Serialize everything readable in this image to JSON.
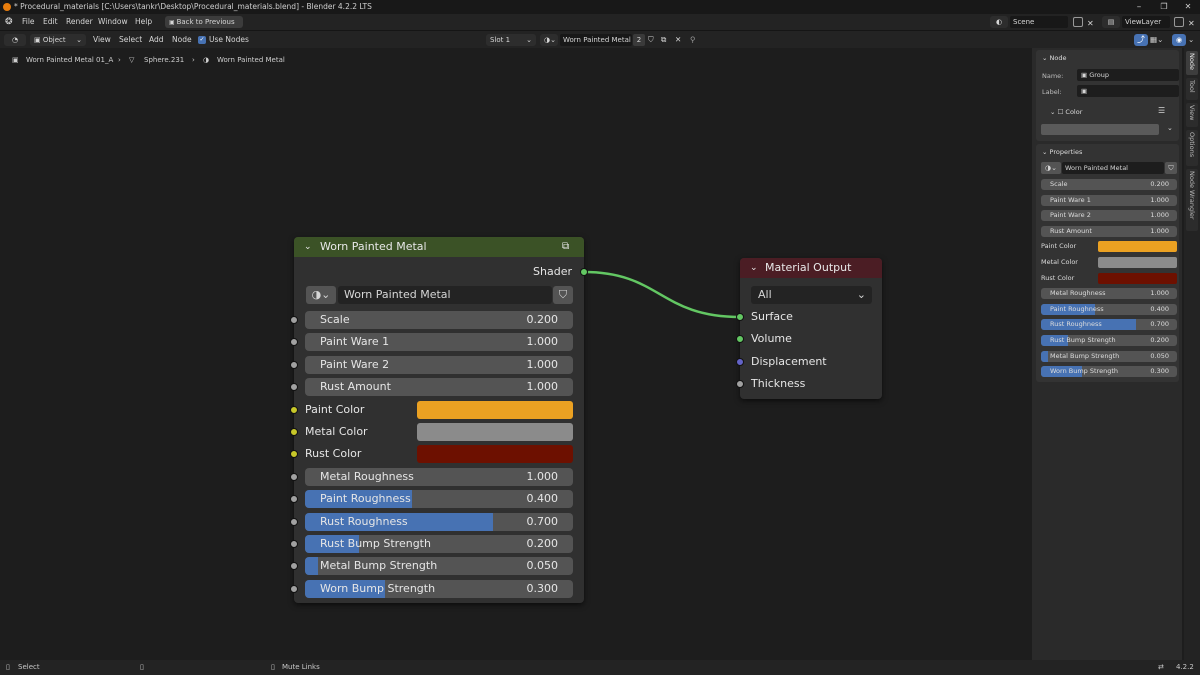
{
  "window": {
    "title": "* Procedural_materials [C:\\Users\\tankr\\Desktop\\Procedural_materials.blend] - Blender 4.2.2 LTS",
    "minimize": "–",
    "maximize": "❐",
    "close": "✕"
  },
  "menu": {
    "items": [
      "File",
      "Edit",
      "Render",
      "Window",
      "Help"
    ],
    "back_button": "Back to Previous",
    "scene": "Scene",
    "view_layer": "ViewLayer"
  },
  "header": {
    "mode": "Object",
    "menus": [
      "View",
      "Select",
      "Add",
      "Node"
    ],
    "use_nodes_label": "Use Nodes",
    "use_nodes_checked": true,
    "slot": "Slot 1",
    "material": "Worn Painted Metal",
    "users": "2"
  },
  "breadcrumb": {
    "object": "Worn Painted Metal 01_A",
    "mesh": "Sphere.231",
    "material": "Worn Painted Metal"
  },
  "group_node": {
    "title": "Worn Painted Metal",
    "output": "Shader",
    "datablock": "Worn Painted Metal",
    "inputs": [
      {
        "label": "Scale",
        "value": "0.200",
        "fill": 0
      },
      {
        "label": "Paint Ware 1",
        "value": "1.000",
        "fill": 0
      },
      {
        "label": "Paint Ware 2",
        "value": "1.000",
        "fill": 0
      },
      {
        "label": "Rust Amount",
        "value": "1.000",
        "fill": 0
      }
    ],
    "colors": [
      {
        "label": "Paint Color",
        "color": "#eba122"
      },
      {
        "label": "Metal Color",
        "color": "#8b8b8b"
      },
      {
        "label": "Rust Color",
        "color": "#6d1000"
      }
    ],
    "factors": [
      {
        "label": "Metal Roughness",
        "value": "1.000",
        "fill": 0
      },
      {
        "label": "Paint Roughness",
        "value": "0.400",
        "fill": 0.4
      },
      {
        "label": "Rust Roughness",
        "value": "0.700",
        "fill": 0.7
      },
      {
        "label": "Rust Bump Strength",
        "value": "0.200",
        "fill": 0.2
      },
      {
        "label": "Metal Bump Strength",
        "value": "0.050",
        "fill": 0.05
      },
      {
        "label": "Worn Bump Strength",
        "value": "0.300",
        "fill": 0.3
      }
    ]
  },
  "output_node": {
    "title": "Material Output",
    "target": "All",
    "inputs": [
      "Surface",
      "Volume",
      "Displacement",
      "Thickness"
    ]
  },
  "sidebar": {
    "node_header": "Node",
    "name_label": "Name:",
    "name_value": "Group",
    "label_label": "Label:",
    "label_value": "",
    "color_label": "Color",
    "properties_header": "Properties",
    "datablock": "Worn Painted Metal",
    "tabs": [
      "Node",
      "Tool",
      "View",
      "Options",
      "Node Wrangler"
    ]
  },
  "status": {
    "select": "Select",
    "mute": "Mute Links",
    "version": "4.2.2"
  },
  "colors": {
    "group_header": "#3b5226",
    "output_header": "#4b1d24",
    "shader_socket": "#63c763",
    "color_socket": "#c7c729",
    "value_socket": "#a1a1a1",
    "vector_socket": "#6363c7",
    "slider_fill": "#4772b3"
  }
}
